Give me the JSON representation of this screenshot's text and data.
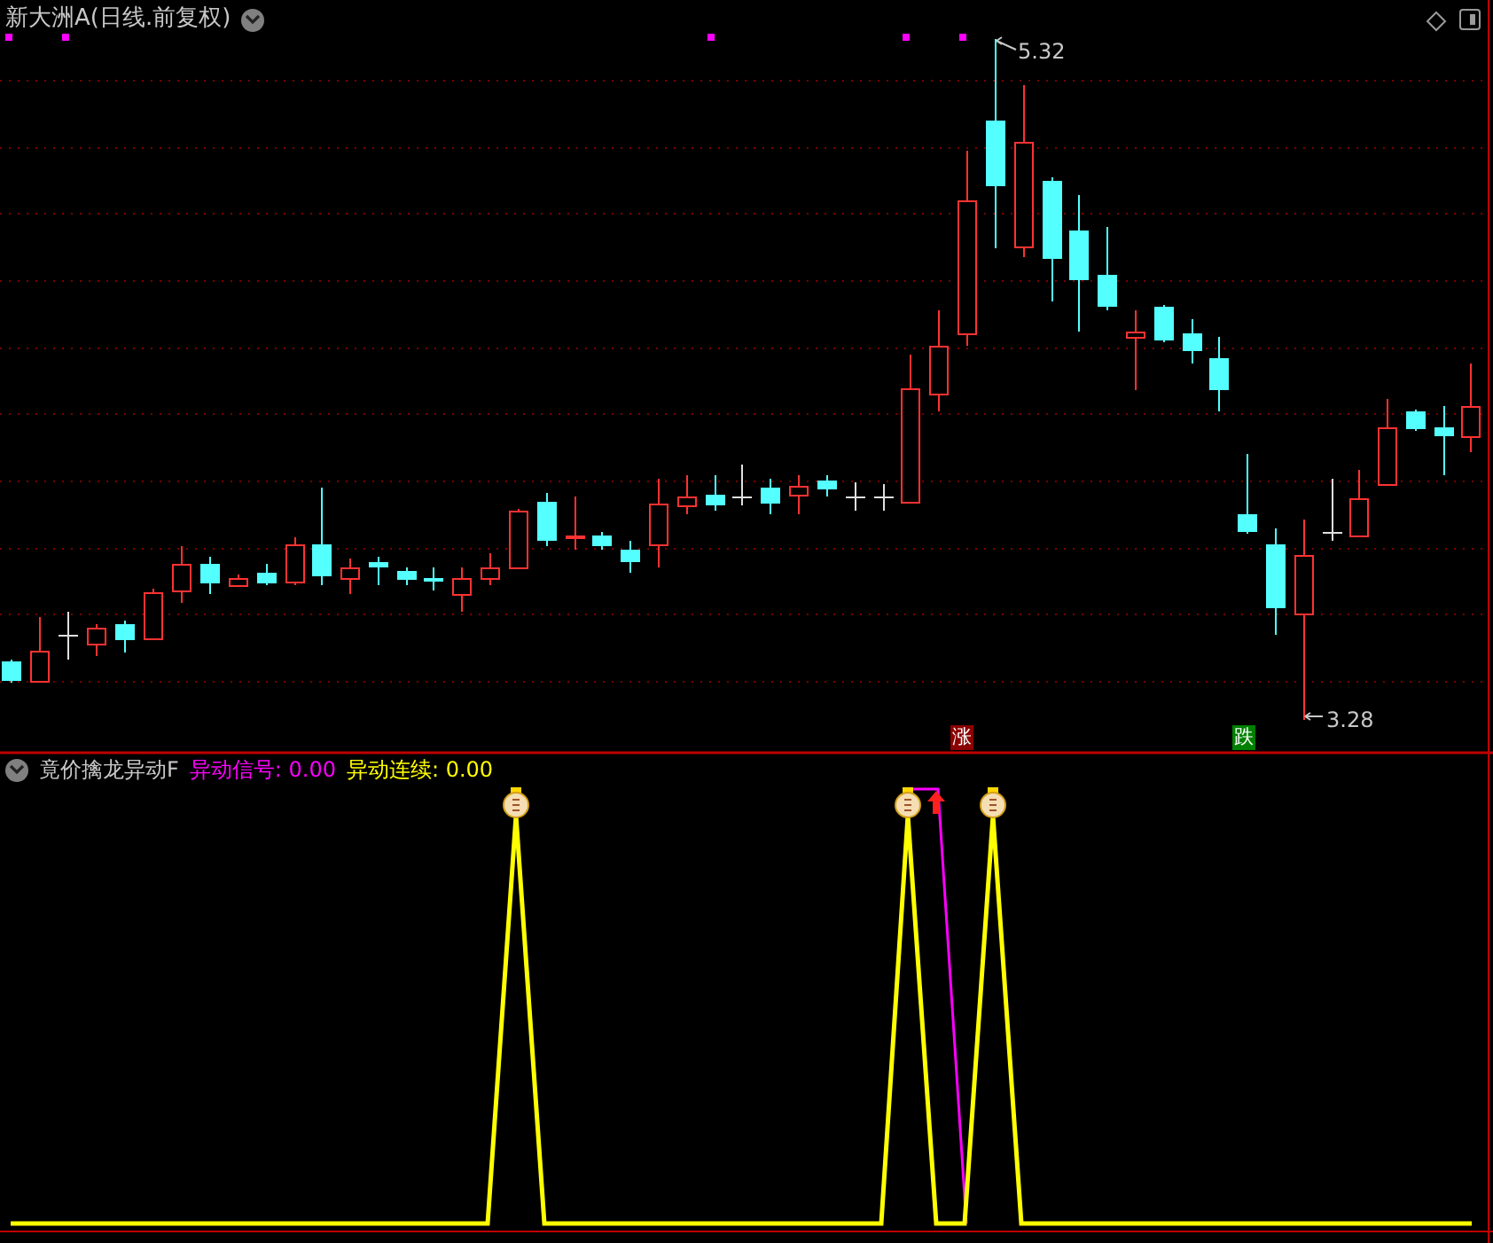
{
  "main_panel": {
    "title": "新大洲A(日线.前复权)",
    "high_label": "5.32",
    "low_label": "3.28",
    "markers": [
      {
        "label": "涨",
        "color": "#8b0000"
      },
      {
        "label": "跌",
        "color": "#008000"
      }
    ]
  },
  "indicator_panel": {
    "title": "竟价擒龙异动F",
    "values": [
      {
        "label": "异动信号: 0.00",
        "color": "#ff00ff"
      },
      {
        "label": "异动连续: 0.00",
        "color": "#ffff00"
      }
    ]
  }
}
